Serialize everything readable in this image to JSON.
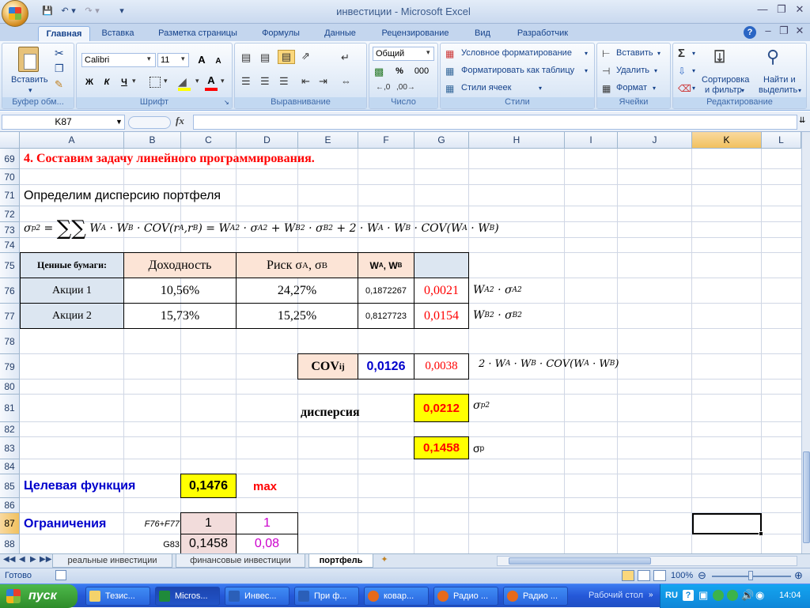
{
  "window": {
    "title": "инвестиции - Microsoft Excel"
  },
  "quick_access": {
    "save_icon": "save-icon",
    "undo_icon": "undo-icon",
    "redo_icon": "redo-icon"
  },
  "ribbon_tabs": [
    "Главная",
    "Вставка",
    "Разметка страницы",
    "Формулы",
    "Данные",
    "Рецензирование",
    "Вид",
    "Разработчик"
  ],
  "ribbon": {
    "clipboard": {
      "label": "Буфер обм...",
      "paste": "Вставить"
    },
    "font": {
      "label": "Шрифт",
      "name": "Calibri",
      "size": "11",
      "bold": "Ж",
      "italic": "К",
      "underline": "Ч",
      "grow": "A",
      "shrink": "A",
      "color_letter": "A"
    },
    "alignment": {
      "label": "Выравнивание"
    },
    "number": {
      "label": "Число",
      "format": "Общий",
      "percent": "%",
      "thousands": "000"
    },
    "styles": {
      "label": "Стили",
      "conditional": "Условное форматирование",
      "as_table": "Форматировать как таблицу",
      "cell_styles": "Стили ячеек"
    },
    "cells": {
      "label": "Ячейки",
      "insert": "Вставить",
      "delete": "Удалить",
      "format": "Формат"
    },
    "editing": {
      "label": "Редактирование",
      "sum": "Σ",
      "sort_line1": "Сортировка",
      "sort_line2": "и фильтр",
      "find_line1": "Найти и",
      "find_line2": "выделить"
    }
  },
  "formula_bar": {
    "name_box": "K87",
    "fx": "fx",
    "formula": ""
  },
  "columns": [
    "A",
    "B",
    "C",
    "D",
    "E",
    "F",
    "G",
    "H",
    "I",
    "J",
    "K",
    "L"
  ],
  "rows": [
    "69",
    "70",
    "71",
    "72",
    "73",
    "74",
    "75",
    "76",
    "77",
    "78",
    "79",
    "80",
    "81",
    "82",
    "83",
    "84",
    "85",
    "86",
    "87",
    "88"
  ],
  "sheet": {
    "heading": "4. Составим задачу линейного программирования.",
    "subheading": "Определим дисперсию портфеля",
    "table": {
      "h_securities": "Ценные бумаги:",
      "h_return": "Доходность",
      "h_risk": "Риск σ",
      "h_risk_sub_a": "A",
      "h_risk_sep": ", σ",
      "h_risk_sub_b": "B",
      "h_w": "W",
      "h_w_sub_a": "A",
      "h_w_sep": ", W",
      "h_w_sub_b": "B",
      "rows": [
        {
          "name": "Акции 1",
          "ret": "10,56%",
          "risk": "24,27%",
          "w": "0,1872267",
          "val": "0,0021"
        },
        {
          "name": "Акции 2",
          "ret": "15,73%",
          "risk": "15,25%",
          "w": "0,8127723",
          "val": "0,0154"
        }
      ]
    },
    "cov_label": "COV",
    "cov_sub": "ij",
    "cov_value": "0,0126",
    "cov_term": "0,0038",
    "variance_label": "дисперсия",
    "variance_value": "0,0212",
    "sigma_value": "0,1458",
    "sigma_label": "σ",
    "sigma_sub": "p",
    "objective_label": "Целевая функция",
    "objective_value": "0,1476",
    "objective_goal": "max",
    "constraints_label": "Ограничения",
    "c1_ref": "F76+F77",
    "c1_value": "1",
    "c1_limit": "1",
    "c2_ref": "G83",
    "c2_value": "0,1458",
    "c2_limit": "0,08"
  },
  "sheet_tabs": [
    "реальные инвестиции",
    "финансовые инвестиции",
    "портфель"
  ],
  "status": {
    "ready": "Готово",
    "zoom": "100%"
  },
  "taskbar": {
    "start": "пуск",
    "tasks": [
      "Тезис...",
      "Micros...",
      "Инвес...",
      "При ф...",
      "ковар...",
      "Радио ...",
      "Радио ..."
    ],
    "desktop": "Рабочий стол",
    "lang": "RU",
    "time": "14:04"
  },
  "colors": {
    "heading_red": "#ff0000",
    "label_blue": "#0000cc",
    "header_fill": "#fce4d6",
    "name_fill": "#dce6f1",
    "result_yellow": "#ffff00",
    "magenta": "#cc00cc"
  }
}
